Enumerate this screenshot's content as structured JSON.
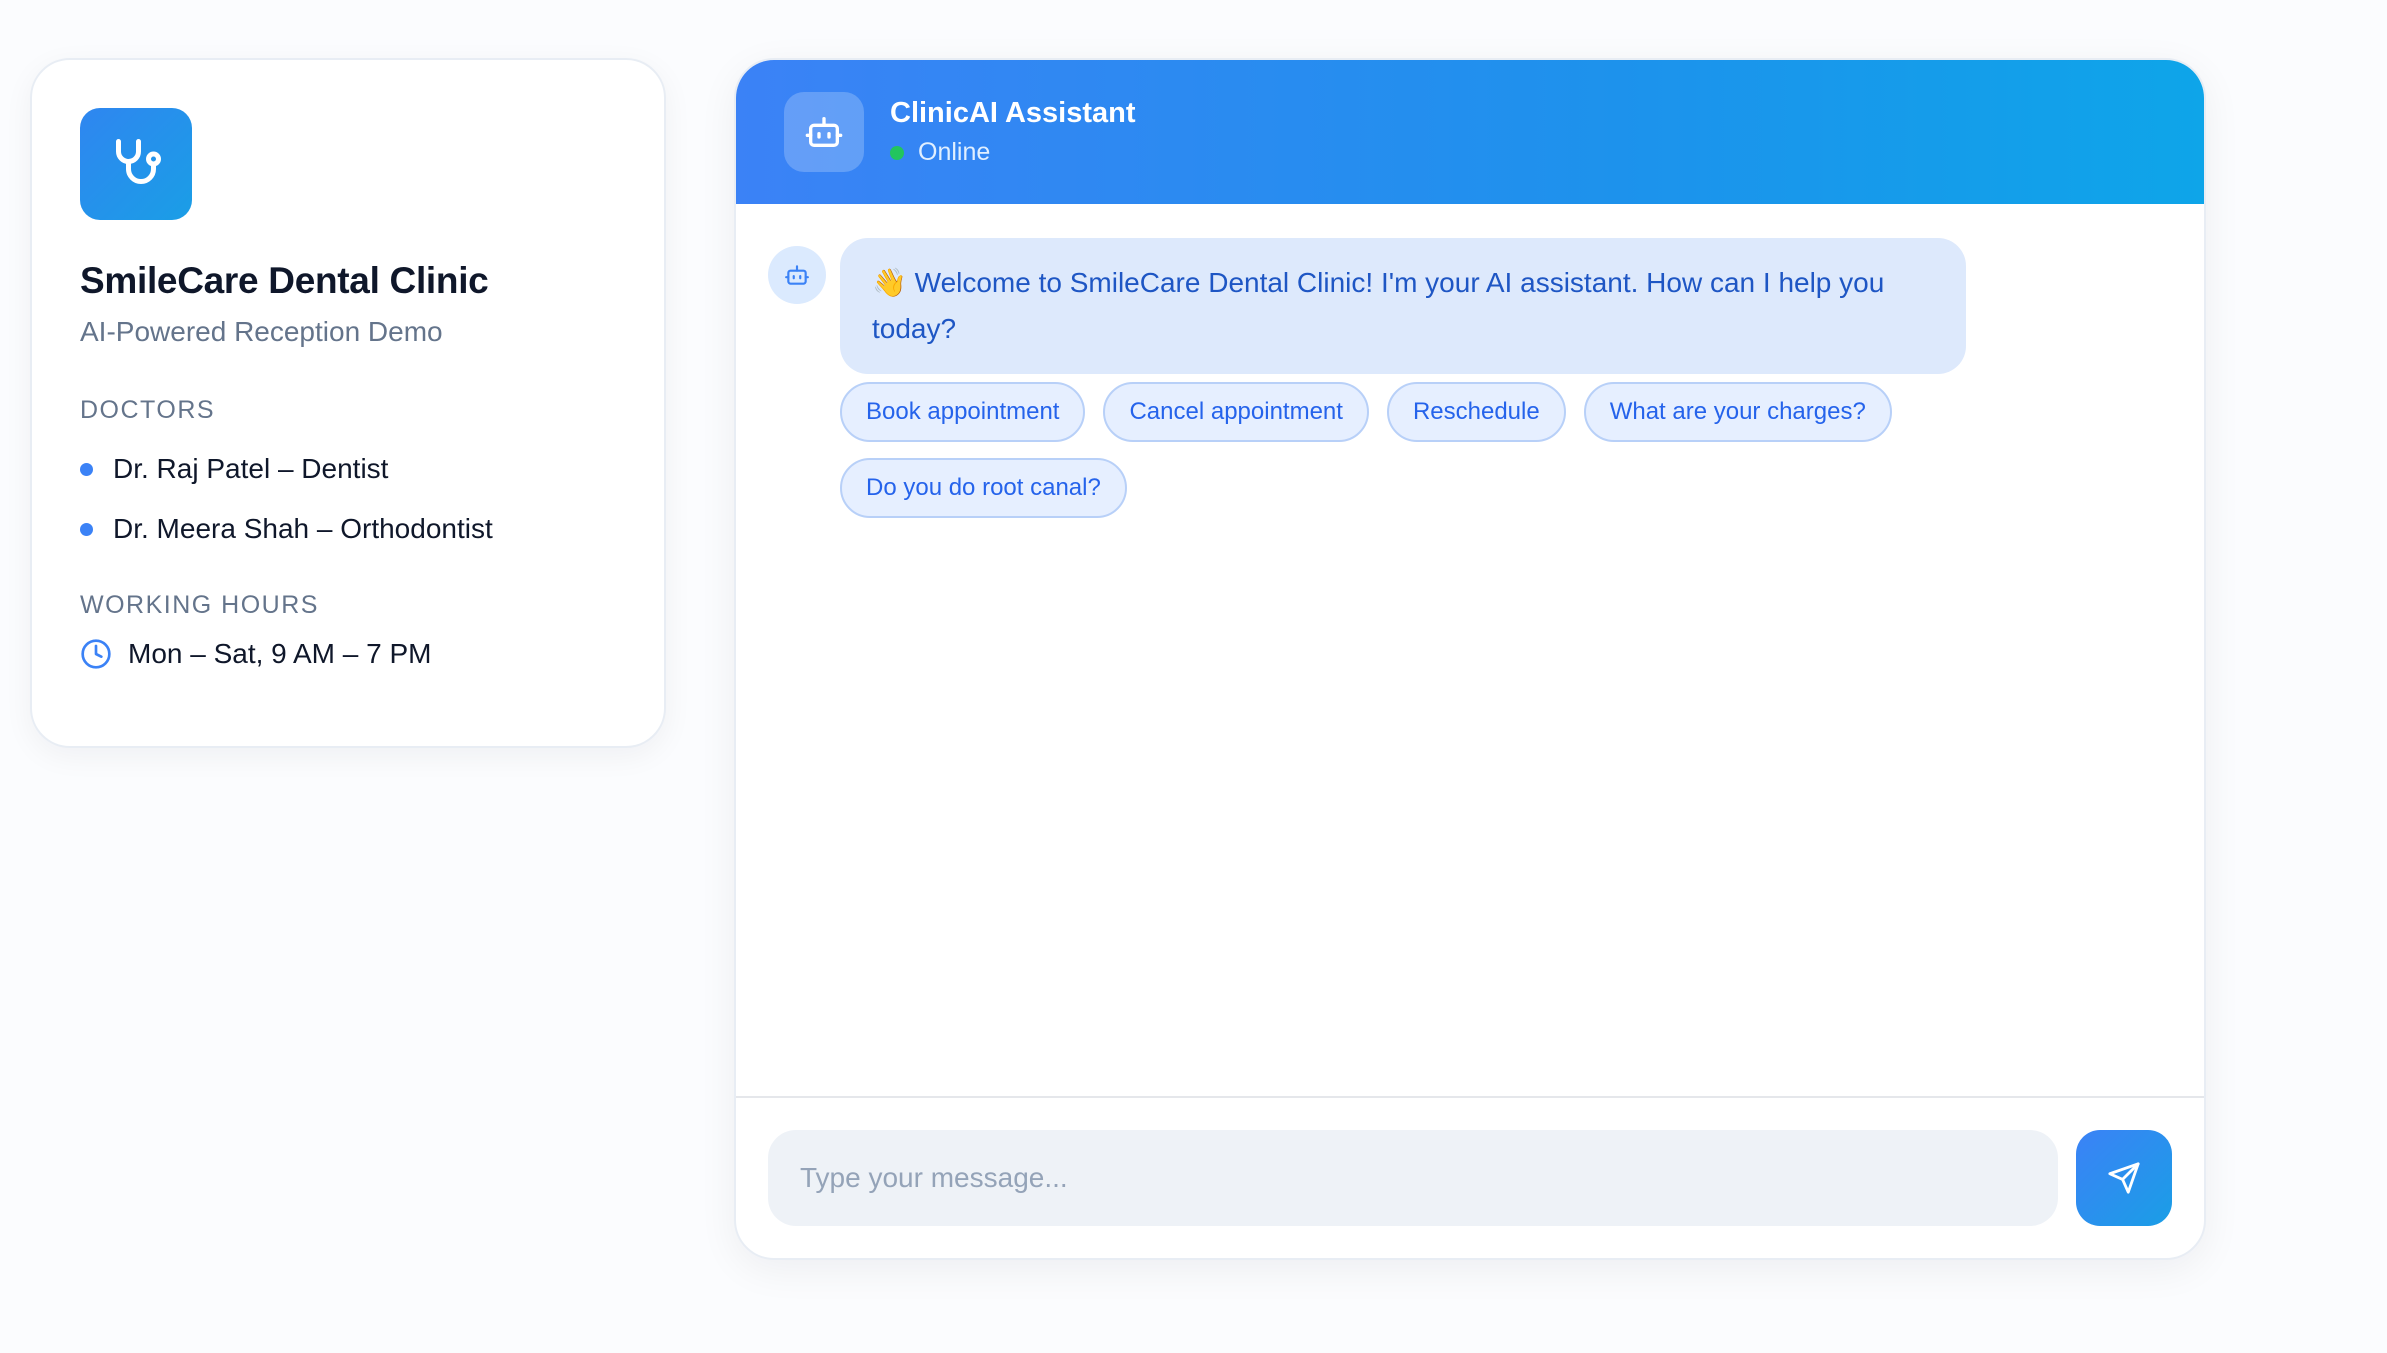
{
  "clinic": {
    "name": "SmileCare Dental Clinic",
    "subtitle": "AI-Powered Reception Demo",
    "logo_icon": "stethoscope-icon",
    "doctors_label": "DOCTORS",
    "doctors": [
      "Dr. Raj Patel – Dentist",
      "Dr. Meera Shah – Orthodontist"
    ],
    "hours_label": "WORKING HOURS",
    "hours": "Mon – Sat, 9 AM – 7 PM",
    "hours_icon": "clock-icon"
  },
  "chat": {
    "assistant_name": "ClinicAI Assistant",
    "status": "Online",
    "status_color": "#22c55e",
    "avatar_icon": "robot-icon",
    "messages": [
      {
        "sender": "bot",
        "text": "👋 Welcome to SmileCare Dental Clinic! I'm your AI assistant. How can I help you today?"
      }
    ],
    "quick_replies": [
      "Book appointment",
      "Cancel appointment",
      "Reschedule",
      "What are your charges?",
      "Do you do root canal?"
    ],
    "input_placeholder": "Type your message...",
    "input_value": "",
    "send_icon": "send-icon"
  },
  "colors": {
    "accent": "#3b82f6",
    "accent_secondary": "#0ea5e9",
    "bubble_bg": "#dde9fc",
    "bubble_text": "#1e56c4"
  }
}
